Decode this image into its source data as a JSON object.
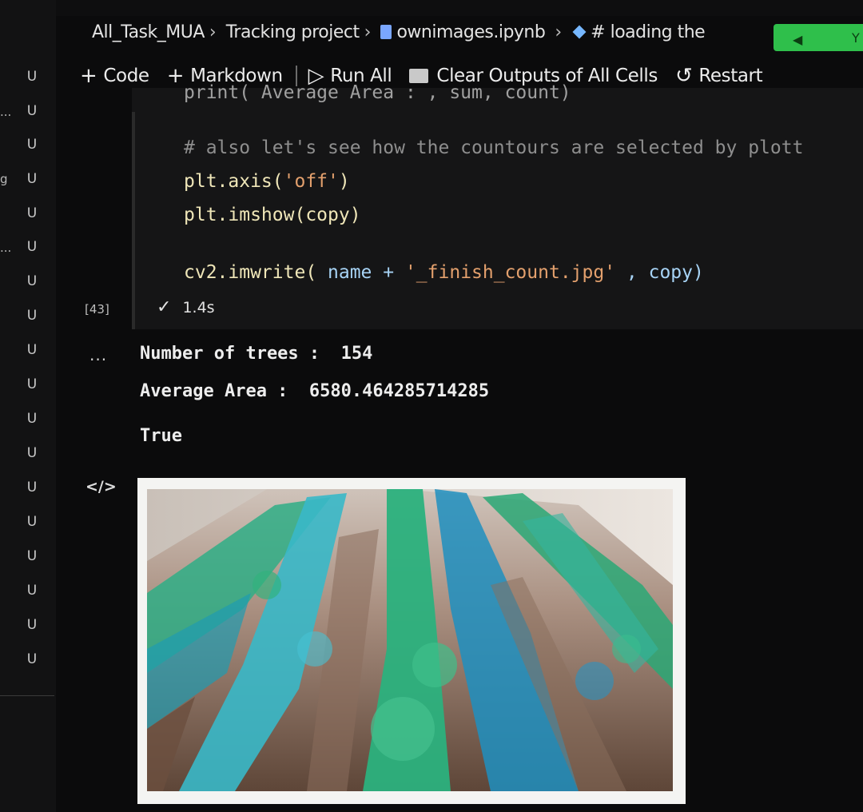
{
  "gutter": {
    "markers": [
      "U",
      "U",
      "U",
      "U",
      "U",
      "U",
      "U",
      "U",
      "U",
      "U",
      "U",
      "U",
      "U",
      "U",
      "U",
      "U",
      "U",
      "U"
    ],
    "trailing": [
      "...",
      "g",
      "..."
    ]
  },
  "breadcrumb": {
    "folder": "All_Task_MUA",
    "project": "Tracking project",
    "file": "ownimages.ipynb",
    "section": "# loading the"
  },
  "toolbar": {
    "code": "Code",
    "markdown": "Markdown",
    "run_all": "Run All",
    "clear_outputs": "Clear Outputs of All Cells",
    "restart": "Restart"
  },
  "cell": {
    "code_lines": {
      "cut": "print( Average Area : , sum, count)",
      "comment": "# also let's see how the countours are selected by plott",
      "axis_call": "plt.axis(",
      "axis_arg": "'off'",
      "axis_close": ")",
      "imshow": "plt.imshow(copy)",
      "imwrite_fn": "cv2.imwrite(",
      "imwrite_name": " name + ",
      "imwrite_str": "'_finish_count.jpg'",
      "imwrite_rest": " , copy)"
    },
    "execution_count": "[43]",
    "duration": "1.4s"
  },
  "output": {
    "ellipsis": "...",
    "trees_line": "Number of trees :  154",
    "area_line": "Average Area :  6580.464285714285",
    "return_value": "True"
  },
  "colors": {
    "background": "#0b0b0c",
    "status_green": "#2fbf4b",
    "string": "#e3a06d",
    "comment": "#8e8e8e"
  }
}
